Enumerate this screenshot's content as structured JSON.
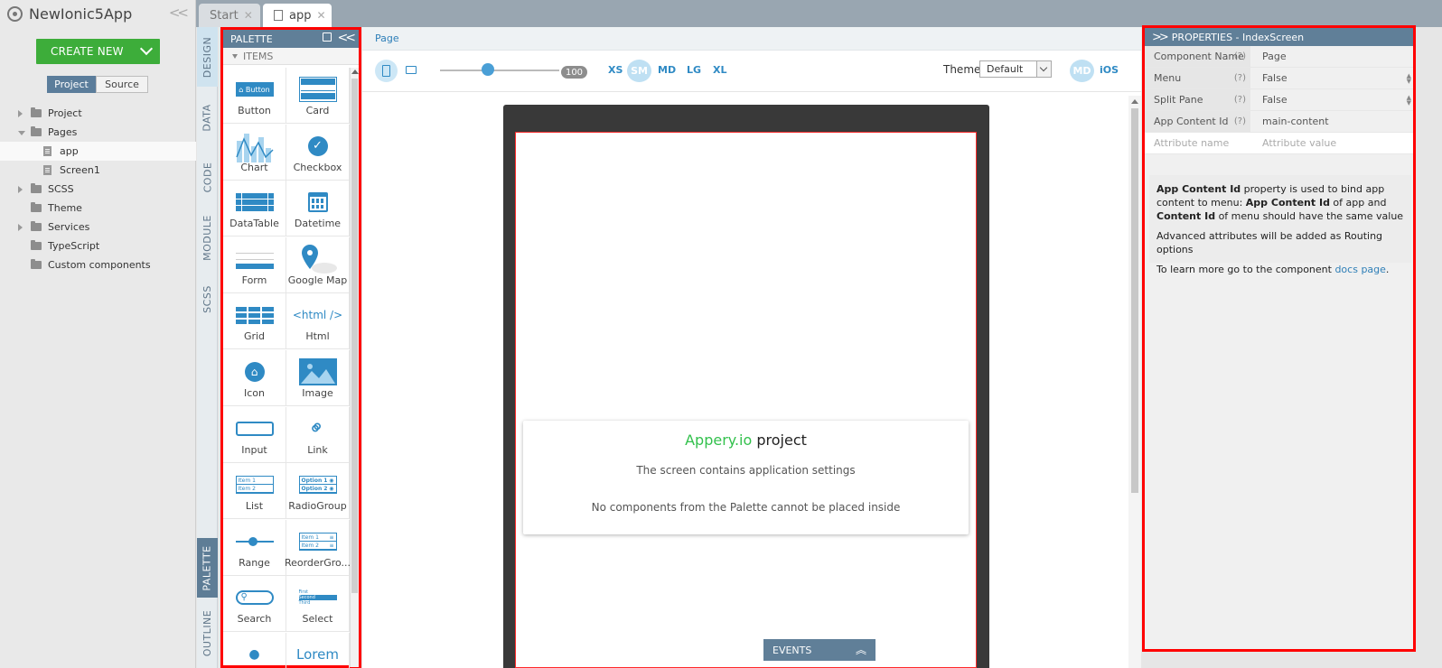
{
  "app": {
    "name": "NewIonic5App",
    "create_new_label": "CREATE NEW"
  },
  "project_tabs": [
    {
      "label": "Project",
      "active": true
    },
    {
      "label": "Source",
      "active": false
    }
  ],
  "tree": [
    {
      "label": "Project",
      "kind": "folder",
      "expandable": true,
      "open": false
    },
    {
      "label": "Pages",
      "kind": "folder",
      "expandable": true,
      "open": true
    },
    {
      "label": "app",
      "kind": "file",
      "child": true,
      "selected": true
    },
    {
      "label": "Screen1",
      "kind": "file",
      "child": true,
      "selected": false
    },
    {
      "label": "SCSS",
      "kind": "folder",
      "expandable": true,
      "open": false
    },
    {
      "label": "Theme",
      "kind": "folder",
      "expandable": false
    },
    {
      "label": "Services",
      "kind": "folder",
      "expandable": true,
      "open": false
    },
    {
      "label": "TypeScript",
      "kind": "folder",
      "expandable": false
    },
    {
      "label": "Custom components",
      "kind": "folder",
      "expandable": false
    }
  ],
  "doc_tabs": [
    {
      "label": "Start",
      "active": false
    },
    {
      "label": "app",
      "active": true
    }
  ],
  "side_tabs": {
    "top": [
      "DESIGN",
      "DATA",
      "CODE",
      "MODULE",
      "SCSS"
    ],
    "bottom": [
      "PALETTE",
      "OUTLINE"
    ]
  },
  "palette": {
    "title": "PALETTE",
    "section": "ITEMS",
    "items": [
      {
        "label": "Button",
        "icon": "button-icon",
        "icon_text": "Button"
      },
      {
        "label": "Card",
        "icon": "card-icon"
      },
      {
        "label": "Chart",
        "icon": "chart-icon"
      },
      {
        "label": "Checkbox",
        "icon": "checkbox-icon"
      },
      {
        "label": "DataTable",
        "icon": "datatable-icon"
      },
      {
        "label": "Datetime",
        "icon": "calendar-icon"
      },
      {
        "label": "Form",
        "icon": "form-icon"
      },
      {
        "label": "Google Map",
        "icon": "map-pin-icon"
      },
      {
        "label": "Grid",
        "icon": "grid-icon"
      },
      {
        "label": "Html",
        "icon": "html-icon",
        "icon_text": "<html />"
      },
      {
        "label": "Icon",
        "icon": "home-icon"
      },
      {
        "label": "Image",
        "icon": "image-icon"
      },
      {
        "label": "Input",
        "icon": "input-icon"
      },
      {
        "label": "Link",
        "icon": "link-icon"
      },
      {
        "label": "List",
        "icon": "list-icon",
        "icon_lines": [
          "Item 1",
          "Item 2"
        ]
      },
      {
        "label": "RadioGroup",
        "icon": "radio-group-icon",
        "icon_lines": [
          "Option 1",
          "Option 2"
        ]
      },
      {
        "label": "Range",
        "icon": "range-icon"
      },
      {
        "label": "ReorderGro...",
        "icon": "reorder-icon",
        "icon_lines": [
          "Item 1",
          "Item 2"
        ]
      },
      {
        "label": "Search",
        "icon": "search-icon"
      },
      {
        "label": "Select",
        "icon": "select-icon"
      },
      {
        "label": "",
        "icon": "dots-icon"
      },
      {
        "label": "",
        "icon": "text-icon",
        "icon_text": "Lorem"
      }
    ]
  },
  "design": {
    "breadcrumb": "Page",
    "zoom_value": "100",
    "zoom_fraction": 0.4,
    "breakpoints": [
      {
        "label": "XS",
        "active": false
      },
      {
        "label": "SM",
        "active": true
      },
      {
        "label": "MD",
        "active": false
      },
      {
        "label": "LG",
        "active": false
      },
      {
        "label": "XL",
        "active": false
      }
    ],
    "theme_label": "Theme:",
    "theme_value": "Default",
    "mode_md": "MD",
    "mode_ios": "iOS",
    "card": {
      "brand": "Appery.io",
      "title_rest": " project",
      "line1": "The screen contains application settings",
      "line2": "No components from the Palette cannot be placed inside"
    },
    "events_label": "EVENTS"
  },
  "properties": {
    "title": "PROPERTIES - IndexScreen",
    "rows": [
      {
        "name": "Component Name",
        "help": "(?)",
        "value": "Page",
        "spinner": false
      },
      {
        "name": "Menu",
        "help": "(?)",
        "value": "False",
        "spinner": true
      },
      {
        "name": "Split Pane",
        "help": "(?)",
        "value": "False",
        "spinner": true
      },
      {
        "name": "App Content Id",
        "help": "(?)",
        "value": "main-content",
        "spinner": false
      }
    ],
    "attr_name_placeholder": "Attribute name",
    "attr_value_placeholder": "Attribute value",
    "desc": {
      "p1_b1": "App Content Id",
      "p1_t1": " property is used to bind app content to menu: ",
      "p1_b2": "App Content Id",
      "p1_t2": " of app and ",
      "p1_b3": "Content Id",
      "p1_t3": " of menu should have the same value",
      "p2": "Advanced attributes will be added as Routing options",
      "p3_text": "To learn more go to the component ",
      "p3_link": "docs page",
      "p3_end": "."
    }
  },
  "colors": {
    "accent": "#2f8ac4",
    "create_button": "#3dad3a",
    "header": "#607f98",
    "highlight_border": "#ff0000",
    "brand_green": "#33c14d"
  }
}
